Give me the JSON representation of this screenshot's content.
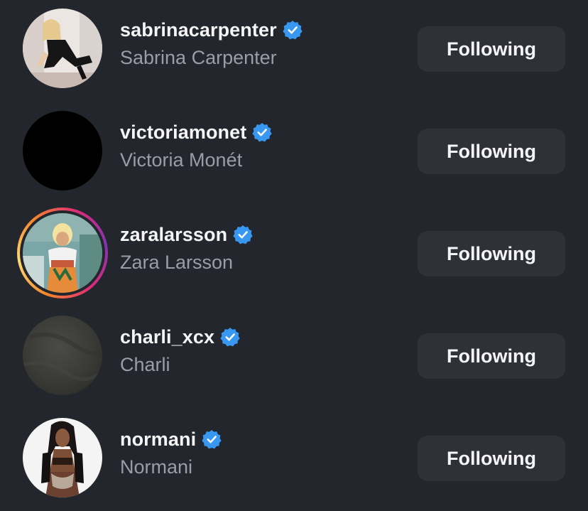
{
  "accounts": [
    {
      "username": "sabrinacarpenter",
      "full_name": "Sabrina Carpenter",
      "verified": true,
      "button_label": "Following",
      "story_ring": false,
      "avatar": "photo-woman-kneeling-black-outfit"
    },
    {
      "username": "victoriamonet",
      "full_name": "Victoria Monét",
      "verified": true,
      "button_label": "Following",
      "story_ring": false,
      "avatar": "solid-black"
    },
    {
      "username": "zaralarsson",
      "full_name": "Zara Larsson",
      "verified": true,
      "button_label": "Following",
      "story_ring": true,
      "avatar": "photo-woman-blonde-colorful"
    },
    {
      "username": "charli_xcx",
      "full_name": "Charli",
      "verified": true,
      "button_label": "Following",
      "story_ring": false,
      "avatar": "dark-gray-texture"
    },
    {
      "username": "normani",
      "full_name": "Normani",
      "verified": true,
      "button_label": "Following",
      "story_ring": false,
      "avatar": "photo-woman-dark-hair-white-bg"
    }
  ],
  "colors": {
    "background": "#23262c",
    "button_bg": "#2e3138",
    "verified_blue": "#3897f0",
    "primary_text": "#f5f5f7",
    "secondary_text": "#9a9da5"
  }
}
